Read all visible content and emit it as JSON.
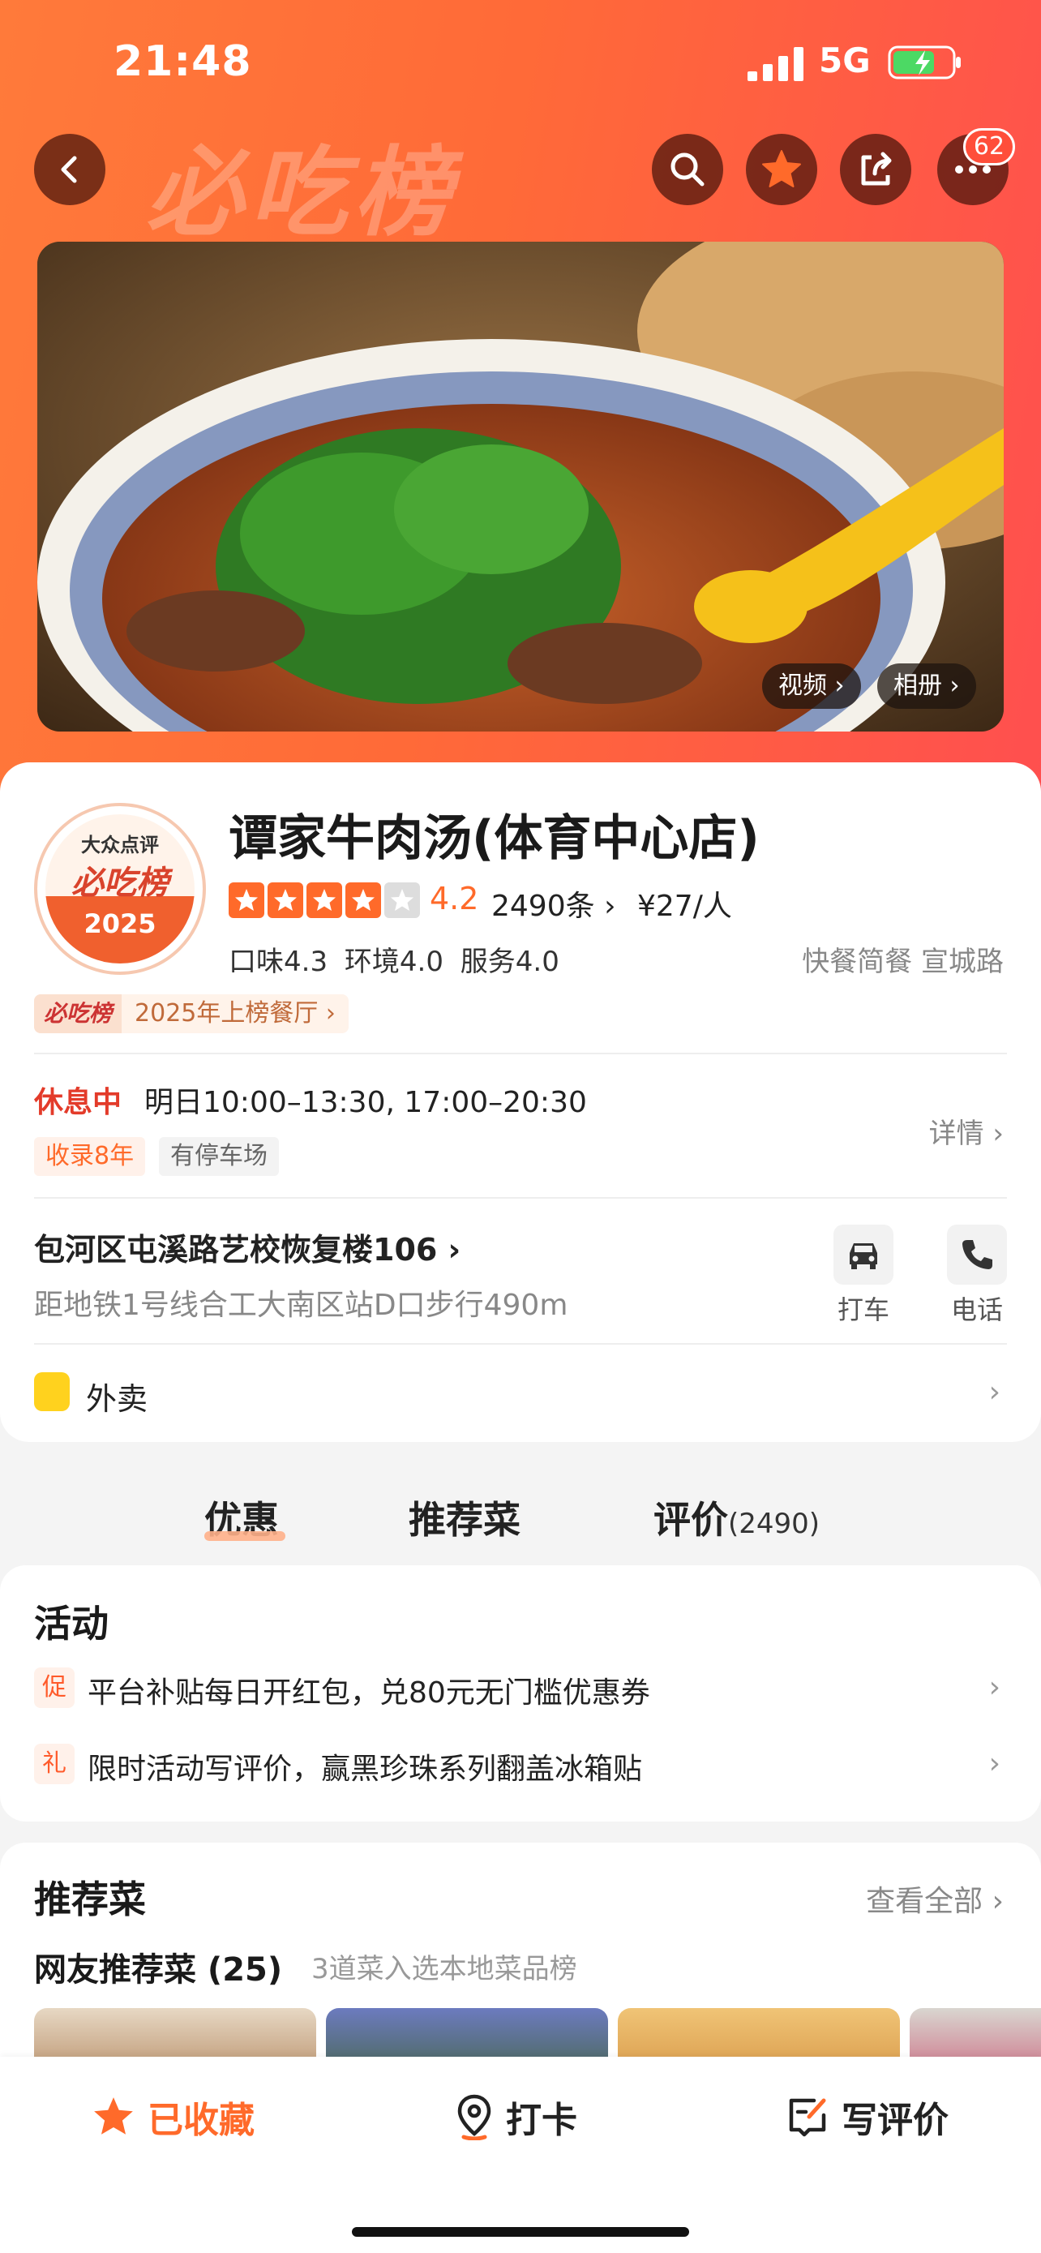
{
  "status_bar": {
    "time": "21:48",
    "network": "5G"
  },
  "header": {
    "watermark": "必吃榜",
    "notification_count": "62"
  },
  "photo": {
    "video_label": "视频",
    "album_label": "相册"
  },
  "shop": {
    "badge_brand": "大众点评",
    "badge_title": "必吃榜",
    "badge_year": "2025",
    "name": "谭家牛肉汤(体育中心店)",
    "stars_filled": 4,
    "rating": "4.2",
    "review_count": "2490条",
    "price": "¥27/人",
    "scores": "口味4.3 环境4.0 服务4.0",
    "category": "快餐简餐 宣城路",
    "rank_tag_brand": "必吃榜",
    "rank_tag_text": "2025年上榜餐厅"
  },
  "hours": {
    "status": "休息中",
    "text": "明日10:00–13:30, 17:00–20:30",
    "detail_label": "详情",
    "tags": [
      "收录8年",
      "有停车场"
    ]
  },
  "location": {
    "address": "包河区屯溪路艺校恢复楼106",
    "subway": "距地铁1号线合工大南区站D口步行490m",
    "taxi_label": "打车",
    "phone_label": "电话"
  },
  "delivery": {
    "label": "外卖"
  },
  "tabs": [
    {
      "label": "优惠"
    },
    {
      "label": "推荐菜"
    },
    {
      "label": "评价",
      "count": "(2490)"
    }
  ],
  "activities": {
    "title": "活动",
    "items": [
      {
        "tag": "促",
        "text": "平台补贴每日开红包，兑80元无门槛优惠券"
      },
      {
        "tag": "礼",
        "text": "限时活动写评价，赢黑珍珠系列翻盖冰箱贴"
      }
    ]
  },
  "dishes": {
    "title": "推荐菜",
    "see_all": "查看全部",
    "subtitle": "网友推荐菜 (25)",
    "note": "3道菜入选本地菜品榜"
  },
  "bottom_bar": {
    "favorite": "已收藏",
    "checkin": "打卡",
    "review": "写评价"
  },
  "colors": {
    "accent": "#ff6a2a",
    "header_start": "#ff7a3a",
    "header_end": "#ff4f4f",
    "alert_red": "#e33b2a"
  }
}
